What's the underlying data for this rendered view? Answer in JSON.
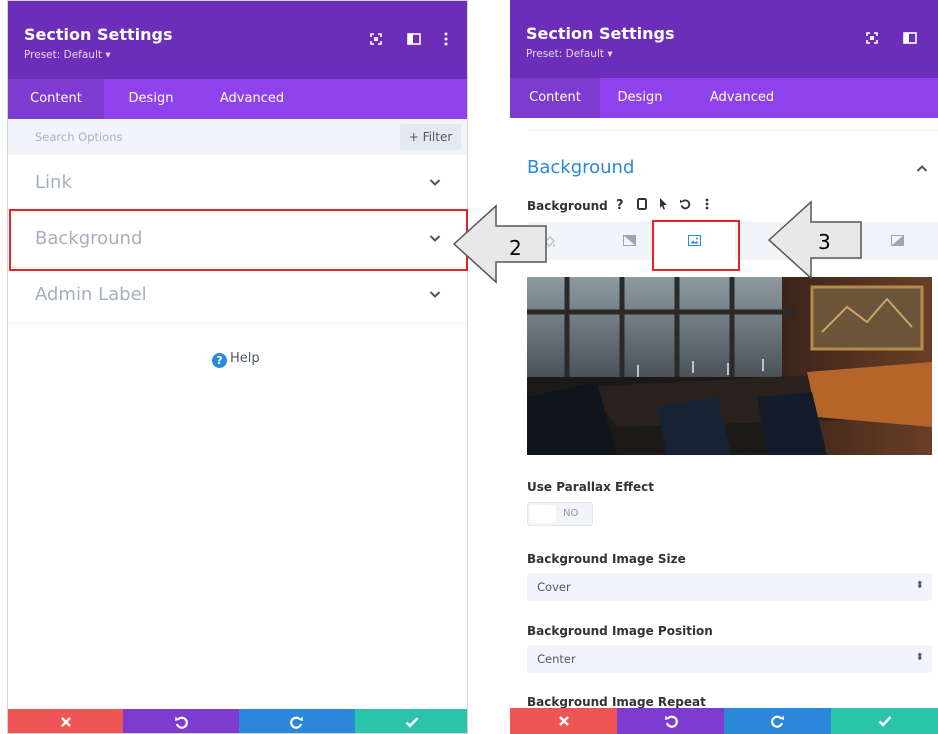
{
  "left_panel": {
    "title": "Section Settings",
    "preset": "Preset: Default ▾",
    "tabs": [
      "Content",
      "Design",
      "Advanced"
    ],
    "search_placeholder": "Search Options",
    "filter_label": "+ Filter",
    "accordion": [
      "Link",
      "Background",
      "Admin Label"
    ],
    "help_label": "Help"
  },
  "right_panel": {
    "title": "Section Settings",
    "preset": "Preset: Default ▾",
    "tabs": [
      "Content",
      "Design",
      "Advanced"
    ],
    "section_title": "Background",
    "background_label": "Background",
    "parallax_label": "Use Parallax Effect",
    "parallax_value": "NO",
    "image_size_label": "Background Image Size",
    "image_size_value": "Cover",
    "image_position_label": "Background Image Position",
    "image_position_value": "Center",
    "image_repeat_label": "Background Image Repeat"
  },
  "callouts": {
    "arrow_2": "2",
    "arrow_3": "3"
  },
  "colors": {
    "header": "#6c2eb9",
    "tabs": "#8f42ec",
    "cancel": "#ef5555",
    "undo": "#7e3bd0",
    "redo": "#2b87da",
    "save": "#29c4a9",
    "highlight": "#e02626"
  },
  "icons": {
    "cancel": "close-icon",
    "undo": "undo-icon",
    "redo": "redo-icon",
    "save": "check-icon"
  }
}
